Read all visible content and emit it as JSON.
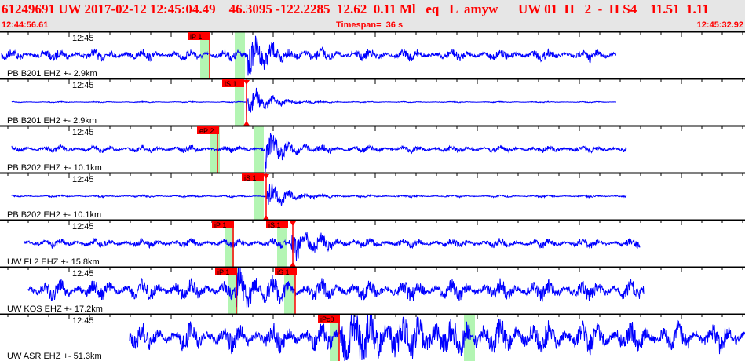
{
  "header": {
    "title": "61249691 UW 2017-02-12 12:45:04.49    46.3095 -122.2285  12.62  0.11 Ml   eq   L  amyw      UW 01  H   2  -  H S4    11.51  1.11",
    "start_time": "12:44:56.61",
    "timespan": "Timespan=  36 s",
    "end_time": "12:45:32.92"
  },
  "colors": {
    "trace": "#0000ff",
    "pick": "#ff0000",
    "window": "#b3f5b3"
  },
  "channels": [
    {
      "label": "PB B201 EHZ +- 2.9km",
      "time_label": "12:45",
      "picks": [
        {
          "label": "iP 1"
        }
      ]
    },
    {
      "label": "PB B201 EH2 +- 2.9km",
      "time_label": "12:45",
      "picks": [
        {
          "label": "iS 1"
        }
      ]
    },
    {
      "label": "PB B202 EHZ +- 10.1km",
      "time_label": "12:45",
      "picks": [
        {
          "label": "eP 2"
        }
      ]
    },
    {
      "label": "PB B202 EH2 +- 10.1km",
      "time_label": "12:45",
      "picks": [
        {
          "label": "iS 1"
        }
      ]
    },
    {
      "label": "UW FL2 EHZ +- 15.8km",
      "time_label": "12:45",
      "picks": [
        {
          "label": "iP 1"
        },
        {
          "label": "iS 1"
        }
      ]
    },
    {
      "label": "UW KOS EHZ +- 17.2km",
      "time_label": "12:45",
      "picks": [
        {
          "label": "iP 1"
        },
        {
          "label": "iS 1"
        }
      ]
    },
    {
      "label": "UW ASR EHZ +- 51.3km",
      "time_label": "12:45",
      "picks": [
        {
          "label": "iPc0"
        }
      ]
    }
  ]
}
